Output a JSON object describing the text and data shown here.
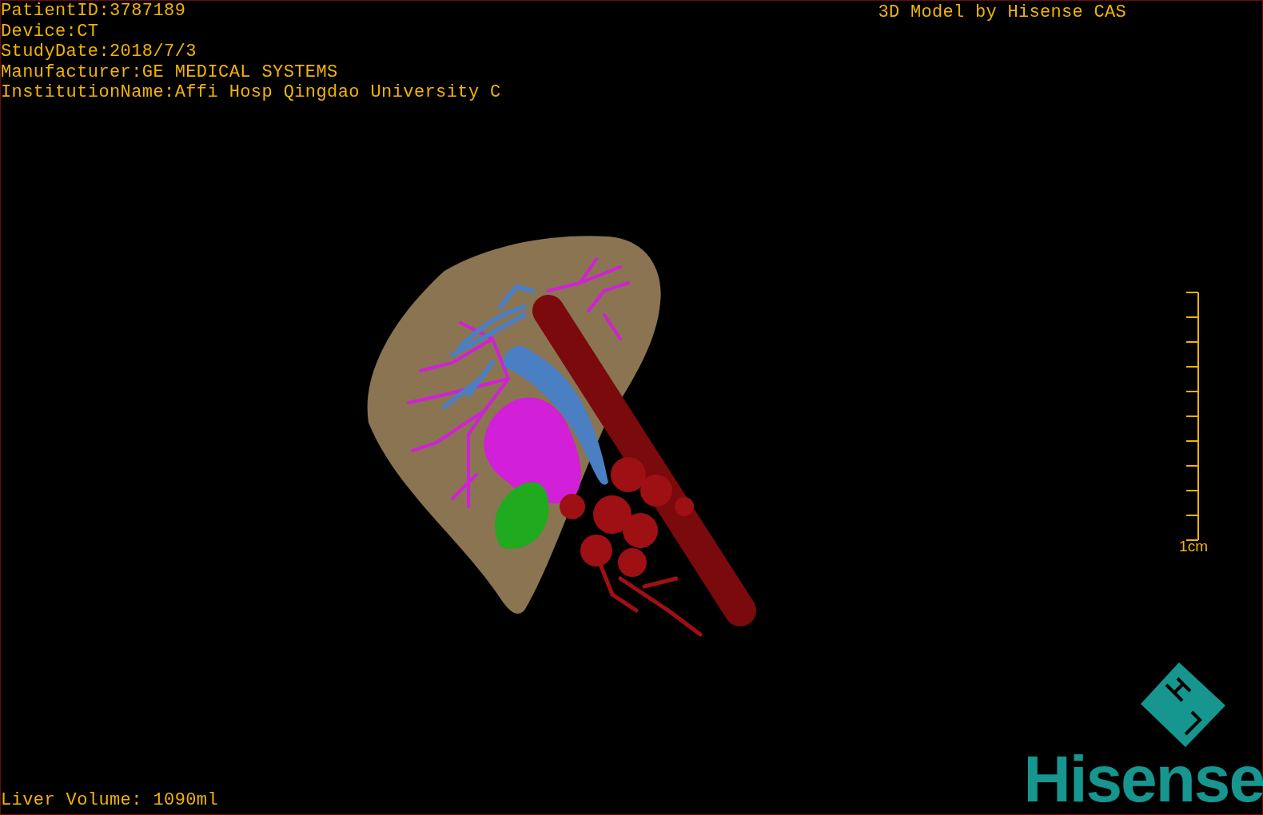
{
  "info": [
    "PatientID:3787189",
    "Device:CT",
    "StudyDate:2018/7/3",
    "Manufacturer:GE MEDICAL SYSTEMS",
    "InstitutionName:Affi Hosp Qingdao University C"
  ],
  "title": "3D Model by Hisense CAS",
  "scale": {
    "label": "1cm"
  },
  "volume": "Liver Volume: 1090ml",
  "logo": {
    "text": "Hisense"
  }
}
